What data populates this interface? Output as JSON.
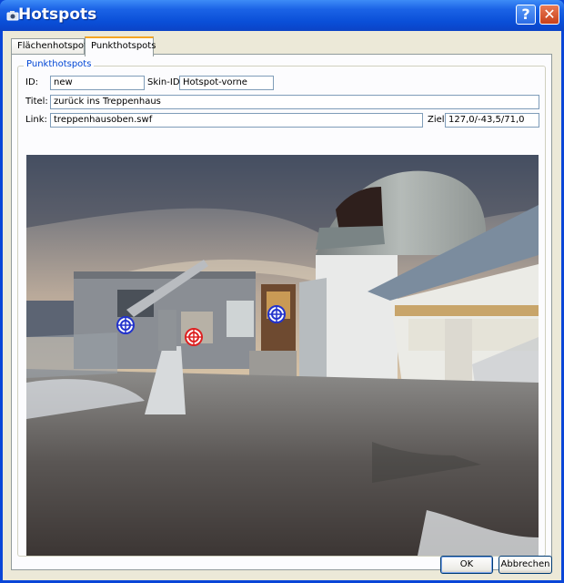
{
  "window": {
    "title": "Hotspots",
    "help_label": "?",
    "close_label": "✕",
    "icons": {
      "app": "camera-app-icon",
      "help": "help-icon",
      "close": "close-icon"
    },
    "colors": {
      "titlebar": "#0a4fd8",
      "close": "#c8401a",
      "accent": "#f5a623"
    }
  },
  "tabs": [
    {
      "label": "Flächenhotspots",
      "selected": false
    },
    {
      "label": "Punkthotspots",
      "selected": true
    }
  ],
  "group": {
    "legend": "Punkthotspots"
  },
  "form": {
    "id_label": "ID:",
    "id_value": "new",
    "skin_label": "Skin-ID:",
    "skin_value": "Hotspot-vorne",
    "title_label": "Titel:",
    "title_value": "zurück ins Treppenhaus",
    "link_label": "Link:",
    "link_value": "treppenhausoben.swf",
    "target_label": "Ziel:",
    "target_value": "127,0/-43,5/71,0"
  },
  "hotspots": [
    {
      "name": "hotspot-marker-blue",
      "color": "#2233cc"
    },
    {
      "name": "hotspot-marker-red",
      "color": "#dd2222"
    },
    {
      "name": "hotspot-marker-blue",
      "color": "#2233cc"
    }
  ],
  "buttons": {
    "ok": "OK",
    "cancel": "Abbrechen"
  }
}
